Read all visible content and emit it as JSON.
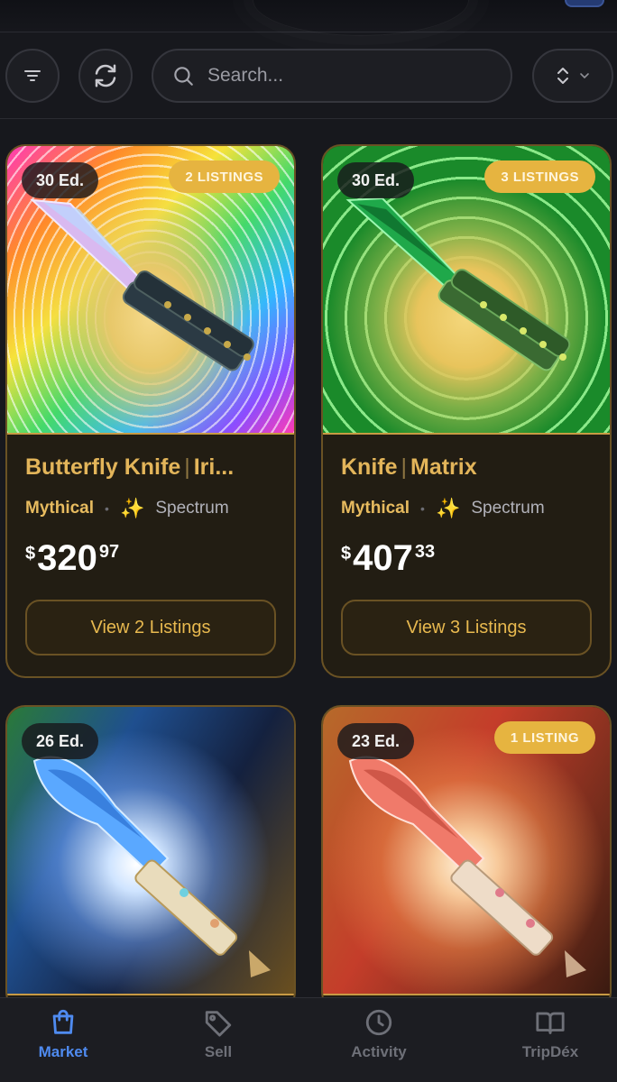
{
  "search": {
    "placeholder": "Search..."
  },
  "colors": {
    "accent_gold": "#e3b55a",
    "badge_gold": "#e6b440",
    "nav_active": "#4f8bf0",
    "background": "#17181d"
  },
  "toolbar": {
    "filter_icon": "filter-icon",
    "refresh_icon": "refresh-icon",
    "sort_icon": "sort-chevrons-icon"
  },
  "cards": [
    {
      "edition": "30 Ed.",
      "listings_badge": "2 LISTINGS",
      "name": "Butterfly Knife",
      "variant": "Iri...",
      "rarity": "Mythical",
      "finish": "Spectrum",
      "price_currency": "$",
      "price_whole": "320",
      "price_cents": "97",
      "button": "View 2 Listings"
    },
    {
      "edition": "30 Ed.",
      "listings_badge": "3 LISTINGS",
      "name": "Knife",
      "variant": "Matrix",
      "rarity": "Mythical",
      "finish": "Spectrum",
      "price_currency": "$",
      "price_whole": "407",
      "price_cents": "33",
      "button": "View 3 Listings"
    },
    {
      "edition": "26 Ed."
    },
    {
      "edition": "23 Ed.",
      "listings_badge": "1 LISTING"
    }
  ],
  "nav": [
    {
      "label": "Market",
      "icon": "shopping-bag-icon",
      "active": true
    },
    {
      "label": "Sell",
      "icon": "tag-icon",
      "active": false
    },
    {
      "label": "Activity",
      "icon": "clock-icon",
      "active": false
    },
    {
      "label": "TripDéx",
      "icon": "book-icon",
      "active": false
    }
  ]
}
